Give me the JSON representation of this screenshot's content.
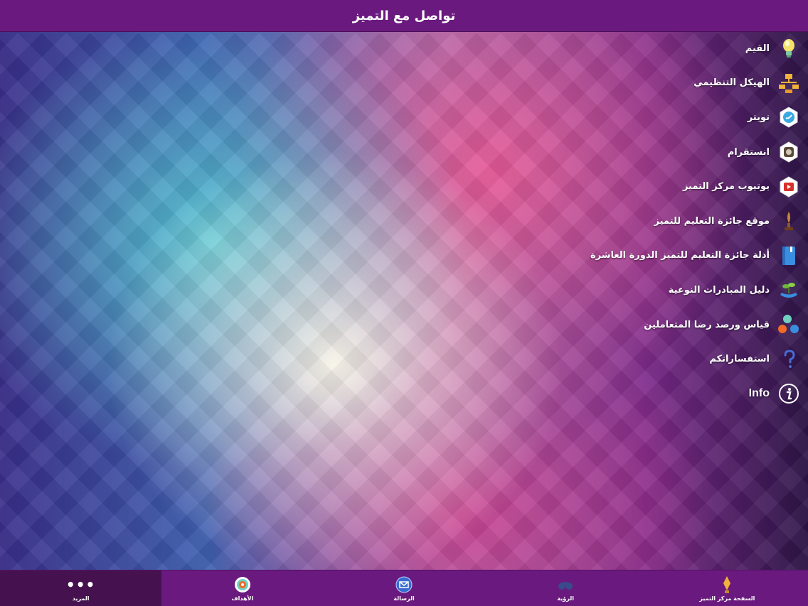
{
  "header": {
    "title": "تواصل مع التميز"
  },
  "menu": [
    {
      "label": "القيم",
      "icon": "lightbulb-icon"
    },
    {
      "label": "الهيكل التنظيمي",
      "icon": "org-chart-icon"
    },
    {
      "label": "تويتر",
      "icon": "twitter-icon"
    },
    {
      "label": "انستقرام",
      "icon": "instagram-icon"
    },
    {
      "label": "يوتيوب مركز التميز",
      "icon": "youtube-icon"
    },
    {
      "label": "موقع جائزة التعليم للتميز",
      "icon": "award-site-icon"
    },
    {
      "label": "أدلة جائزة التعليم للتميز الدورة العاشرة",
      "icon": "book-icon"
    },
    {
      "label": "دليل المبادرات النوعية",
      "icon": "plant-icon"
    },
    {
      "label": "قياس ورصد رضا المتعاملين",
      "icon": "people-icon"
    },
    {
      "label": "استفساراتكم",
      "icon": "question-icon"
    },
    {
      "label": "Info",
      "icon": "info-icon"
    }
  ],
  "tabs": [
    {
      "label": "المزيد",
      "icon": "more-icon",
      "active": true
    },
    {
      "label": "الأهداف",
      "icon": "target-icon",
      "active": false
    },
    {
      "label": "الرسالة",
      "icon": "mail-icon",
      "active": false
    },
    {
      "label": "الرؤية",
      "icon": "binoculars-icon",
      "active": false
    },
    {
      "label": "السفحة مركز التميز",
      "icon": "trophy-icon",
      "active": false
    }
  ],
  "colors": {
    "header": "#6a1a7e",
    "tab_active": "#45124f"
  }
}
